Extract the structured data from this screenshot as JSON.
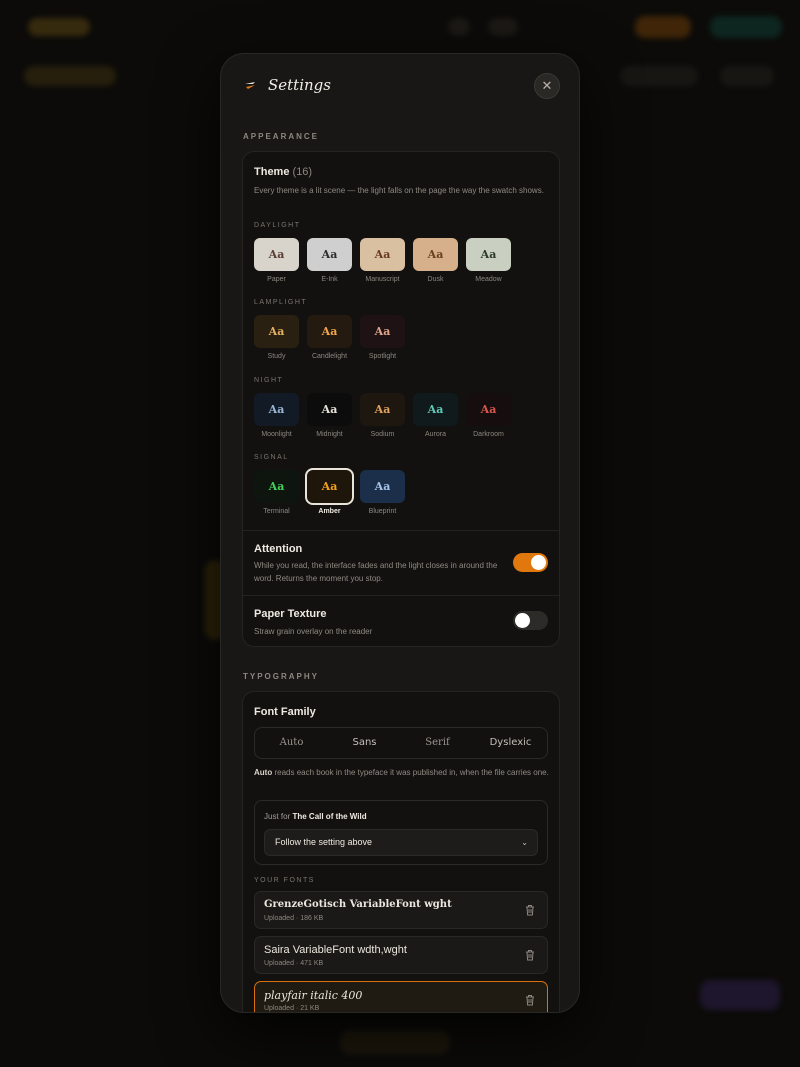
{
  "header": {
    "title": "Settings"
  },
  "appearance": {
    "section_label": "APPEARANCE",
    "theme": {
      "title": "Theme",
      "count": "(16)",
      "description": "Every theme is a lit scene — the light falls on the page the way the swatch shows.",
      "groups": [
        {
          "label": "DAYLIGHT",
          "swatches": [
            {
              "name": "Paper",
              "glyph": "Aa",
              "bg": "#d8d4cc",
              "fg": "#5a3e32"
            },
            {
              "name": "E-Ink",
              "glyph": "Aa",
              "bg": "#cfcfcf",
              "fg": "#2c2c2c"
            },
            {
              "name": "Manuscript",
              "glyph": "Aa",
              "bg": "#d9c0a0",
              "fg": "#6a3a22"
            },
            {
              "name": "Dusk",
              "glyph": "Aa",
              "bg": "#d6b08a",
              "fg": "#6b4020"
            },
            {
              "name": "Meadow",
              "glyph": "Aa",
              "bg": "#c9d0c2",
              "fg": "#2d3a2a"
            }
          ]
        },
        {
          "label": "LAMPLIGHT",
          "swatches": [
            {
              "name": "Study",
              "glyph": "Aa",
              "bg": "#2a2011",
              "fg": "#e4b066"
            },
            {
              "name": "Candlelight",
              "glyph": "Aa",
              "bg": "#241a0f",
              "fg": "#f0a64a"
            },
            {
              "name": "Spotlight",
              "glyph": "Aa",
              "bg": "#1e1214",
              "fg": "#e0a48a"
            }
          ]
        },
        {
          "label": "NIGHT",
          "swatches": [
            {
              "name": "Moonlight",
              "glyph": "Aa",
              "bg": "#121a26",
              "fg": "#9ab7d6"
            },
            {
              "name": "Midnight",
              "glyph": "Aa",
              "bg": "#0c0c0d",
              "fg": "#e8e3d8"
            },
            {
              "name": "Sodium",
              "glyph": "Aa",
              "bg": "#1d1710",
              "fg": "#e0a25e"
            },
            {
              "name": "Aurora",
              "glyph": "Aa",
              "bg": "#101a1c",
              "fg": "#5fc9b6"
            },
            {
              "name": "Darkroom",
              "glyph": "Aa",
              "bg": "#160e0e",
              "fg": "#d9564a"
            }
          ]
        },
        {
          "label": "SIGNAL",
          "swatches": [
            {
              "name": "Terminal",
              "glyph": "Aa",
              "bg": "#0e140e",
              "fg": "#43d15a"
            },
            {
              "name": "Amber",
              "glyph": "Aa",
              "bg": "#1e150b",
              "fg": "#f3a21e",
              "selected": true
            },
            {
              "name": "Blueprint",
              "glyph": "Aa",
              "bg": "#1b2e4a",
              "fg": "#a8c4e8"
            }
          ]
        }
      ]
    },
    "attention": {
      "title": "Attention",
      "description": "While you read, the interface fades and the light closes in around the word. Returns the moment you stop.",
      "on": true
    },
    "paper_texture": {
      "title": "Paper Texture",
      "description": "Straw grain overlay on the reader",
      "on": false
    }
  },
  "typography": {
    "section_label": "TYPOGRAPHY",
    "font_family": {
      "title": "Font Family",
      "options": [
        "Auto",
        "Sans",
        "Serif",
        "Dyslexic"
      ],
      "note_bold": "Auto",
      "note": "reads each book in the typeface it was published in, when the file carries one."
    },
    "override": {
      "label_prefix": "Just for",
      "book_title": "The Call of the Wild",
      "select_value": "Follow the setting above"
    },
    "your_fonts_label": "YOUR FONTS",
    "fonts": [
      {
        "name": "GrenzeGotisch VariableFont wght",
        "meta": "Uploaded · 186 KB"
      },
      {
        "name": "Saira VariableFont wdth,wght",
        "meta": "Uploaded · 471 KB"
      },
      {
        "name": "playfair italic 400",
        "meta": "Uploaded · 21 KB",
        "active": true
      }
    ]
  },
  "colors": {
    "accent": "#e0780e",
    "modal_bg": "#181715"
  },
  "icons": {
    "logo": "lightning-logo-icon",
    "close": "close-icon",
    "delete": "trash-icon",
    "select": "chevron-down-icon"
  }
}
